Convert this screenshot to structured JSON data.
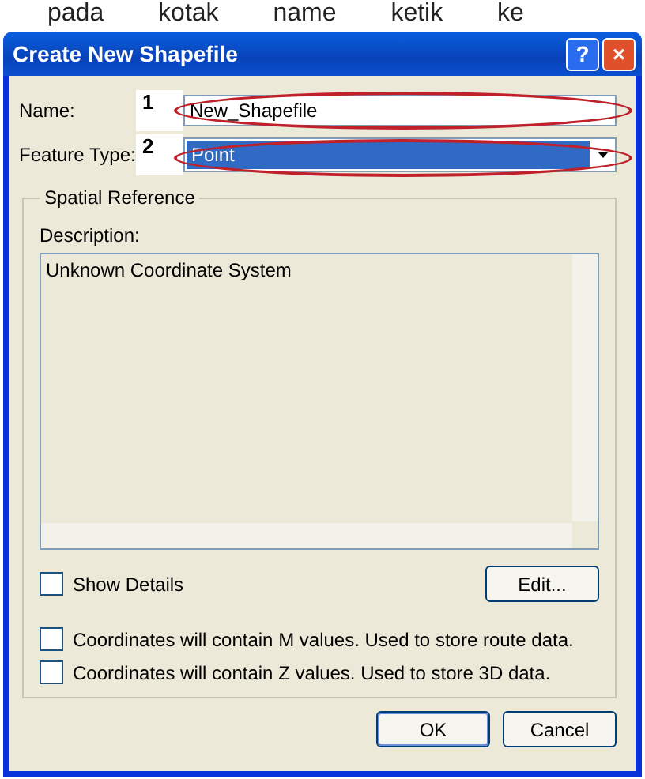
{
  "page_caption": "pada kotak name ketik ke",
  "window": {
    "title": "Create New Shapefile",
    "buttons": [
      "?",
      "×"
    ]
  },
  "name_field": {
    "label": "Name:",
    "value": "New_Shapefile",
    "annotation": "1"
  },
  "feature_type": {
    "label": "Feature Type:",
    "value": "Point",
    "annotation": "2"
  },
  "spatial_reference": {
    "title": "Spatial Reference",
    "description_label": "Description:",
    "description": "Unknown Coordinate System",
    "show_details": {
      "label": "Show Details",
      "checked": false
    },
    "edit_button": "Edit..."
  },
  "options": [
    {
      "label": "Coordinates will contain M values. Used to store route data.",
      "checked": false
    },
    {
      "label": "Coordinates will contain Z values. Used to store 3D data.",
      "checked": false
    }
  ],
  "buttons": [
    {
      "label": "OK",
      "default": true
    },
    {
      "label": "Cancel",
      "default": false
    }
  ]
}
